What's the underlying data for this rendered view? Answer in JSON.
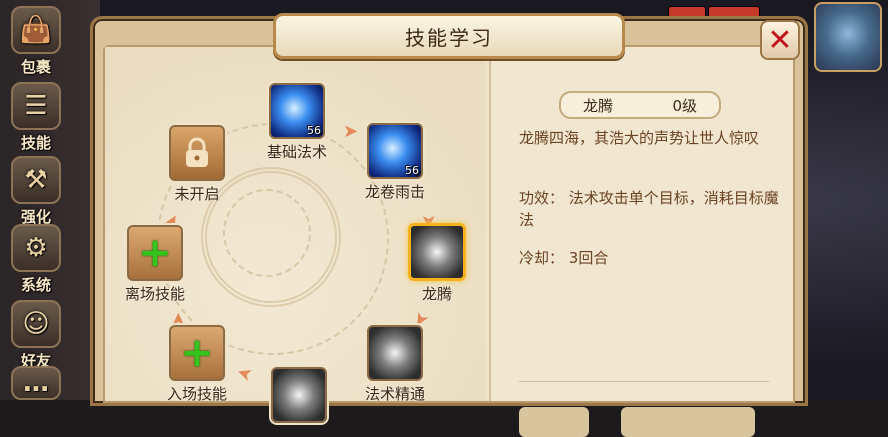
{
  "sidebar": {
    "items": [
      {
        "label": "包裹",
        "icon": "bag-icon"
      },
      {
        "label": "技能",
        "icon": "skill-book-icon"
      },
      {
        "label": "强化",
        "icon": "hammer-icon"
      },
      {
        "label": "系统",
        "icon": "gear-icon"
      },
      {
        "label": "好友",
        "icon": "friend-avatar-icon"
      }
    ]
  },
  "dialog": {
    "title": "技能学习",
    "close_icon": "close-x-icon"
  },
  "skill_tree": {
    "nodes": [
      {
        "id": "basic",
        "label": "基础法术",
        "level": "56",
        "icon": "blue-orb-icon"
      },
      {
        "id": "tornado",
        "label": "龙卷雨击",
        "level": "56",
        "icon": "blue-storm-icon"
      },
      {
        "id": "dragon",
        "label": "龙腾",
        "level": "",
        "icon": "dragon-icon",
        "selected": true
      },
      {
        "id": "mastery",
        "label": "法术精通",
        "level": "",
        "icon": "grey-dragon-icon"
      },
      {
        "id": "enter",
        "label": "入场技能",
        "level": "",
        "icon": "plus-icon"
      },
      {
        "id": "leave",
        "label": "离场技能",
        "level": "",
        "icon": "plus-icon"
      },
      {
        "id": "locked",
        "label": "未开启",
        "level": "",
        "icon": "lock-icon"
      }
    ]
  },
  "detail": {
    "name": "龙腾",
    "level": "0级",
    "description": "龙腾四海，其浩大的声势让世人惊叹",
    "effect_label": "功效：",
    "effect_text": "法术攻击单个目标，消耗目标魔法",
    "cooldown_label": "冷却：",
    "cooldown_text": "3回合"
  },
  "colors": {
    "panel_border": "#9b7747",
    "selected_border": "#f5b21a",
    "desc_text": "#6b4222",
    "close_x": "#c0141b"
  }
}
